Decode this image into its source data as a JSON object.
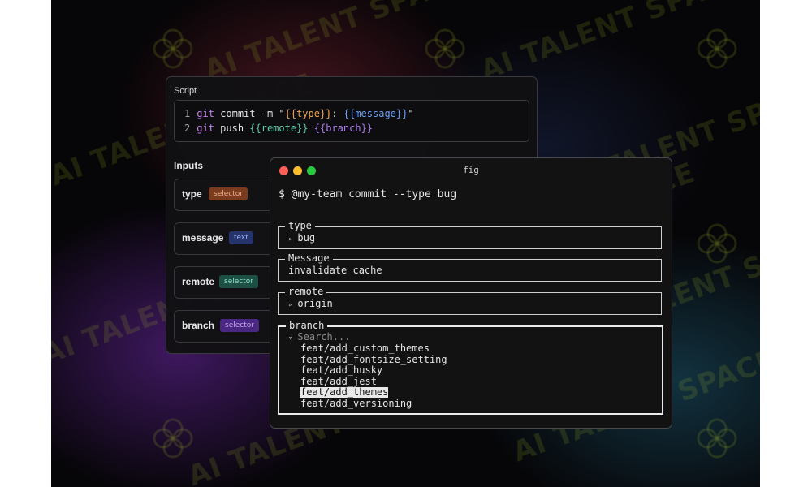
{
  "watermark": "AI TALENT SPACE",
  "script_panel": {
    "script_label": "Script",
    "code_lines": [
      {
        "number": "1",
        "parts": [
          {
            "text": "git",
            "cls": "kw"
          },
          {
            "text": " commit -m \"",
            "cls": ""
          },
          {
            "text": "{{type}}",
            "cls": "tok-orange"
          },
          {
            "text": ": ",
            "cls": ""
          },
          {
            "text": "{{message}}",
            "cls": "tok-blue"
          },
          {
            "text": "\"",
            "cls": ""
          }
        ]
      },
      {
        "number": "2",
        "parts": [
          {
            "text": "git",
            "cls": "kw"
          },
          {
            "text": " push ",
            "cls": ""
          },
          {
            "text": "{{remote}}",
            "cls": "tok-teal"
          },
          {
            "text": " ",
            "cls": ""
          },
          {
            "text": "{{branch}}",
            "cls": "tok-purple"
          }
        ]
      }
    ],
    "inputs_label": "Inputs",
    "inputs": [
      {
        "name": "type",
        "badge": "selector",
        "badge_color": "#7a3b1f"
      },
      {
        "name": "message",
        "badge": "text",
        "badge_color": "#26346b"
      },
      {
        "name": "remote",
        "badge": "selector",
        "badge_color": "#1d4f45"
      },
      {
        "name": "branch",
        "badge": "selector",
        "badge_color": "#4a2781"
      }
    ]
  },
  "terminal": {
    "title": "fig",
    "prompt": "$ @my-team commit --type bug",
    "fields": {
      "type": {
        "label": "type",
        "value": "bug"
      },
      "message": {
        "label": "Message",
        "value": "invalidate cache"
      },
      "remote": {
        "label": "remote",
        "value": "origin"
      }
    },
    "branch": {
      "label": "branch",
      "search_placeholder": "Search...",
      "items": [
        "feat/add_custom_themes",
        "feat/add_fontsize_setting",
        "feat/add_husky",
        "feat/add_jest",
        "feat/add_themes",
        "feat/add_versioning"
      ],
      "selected": "feat/add_themes"
    }
  },
  "colors": {
    "window_red": "#ff5f57",
    "window_yellow": "#febc2e",
    "window_green": "#28c840"
  }
}
